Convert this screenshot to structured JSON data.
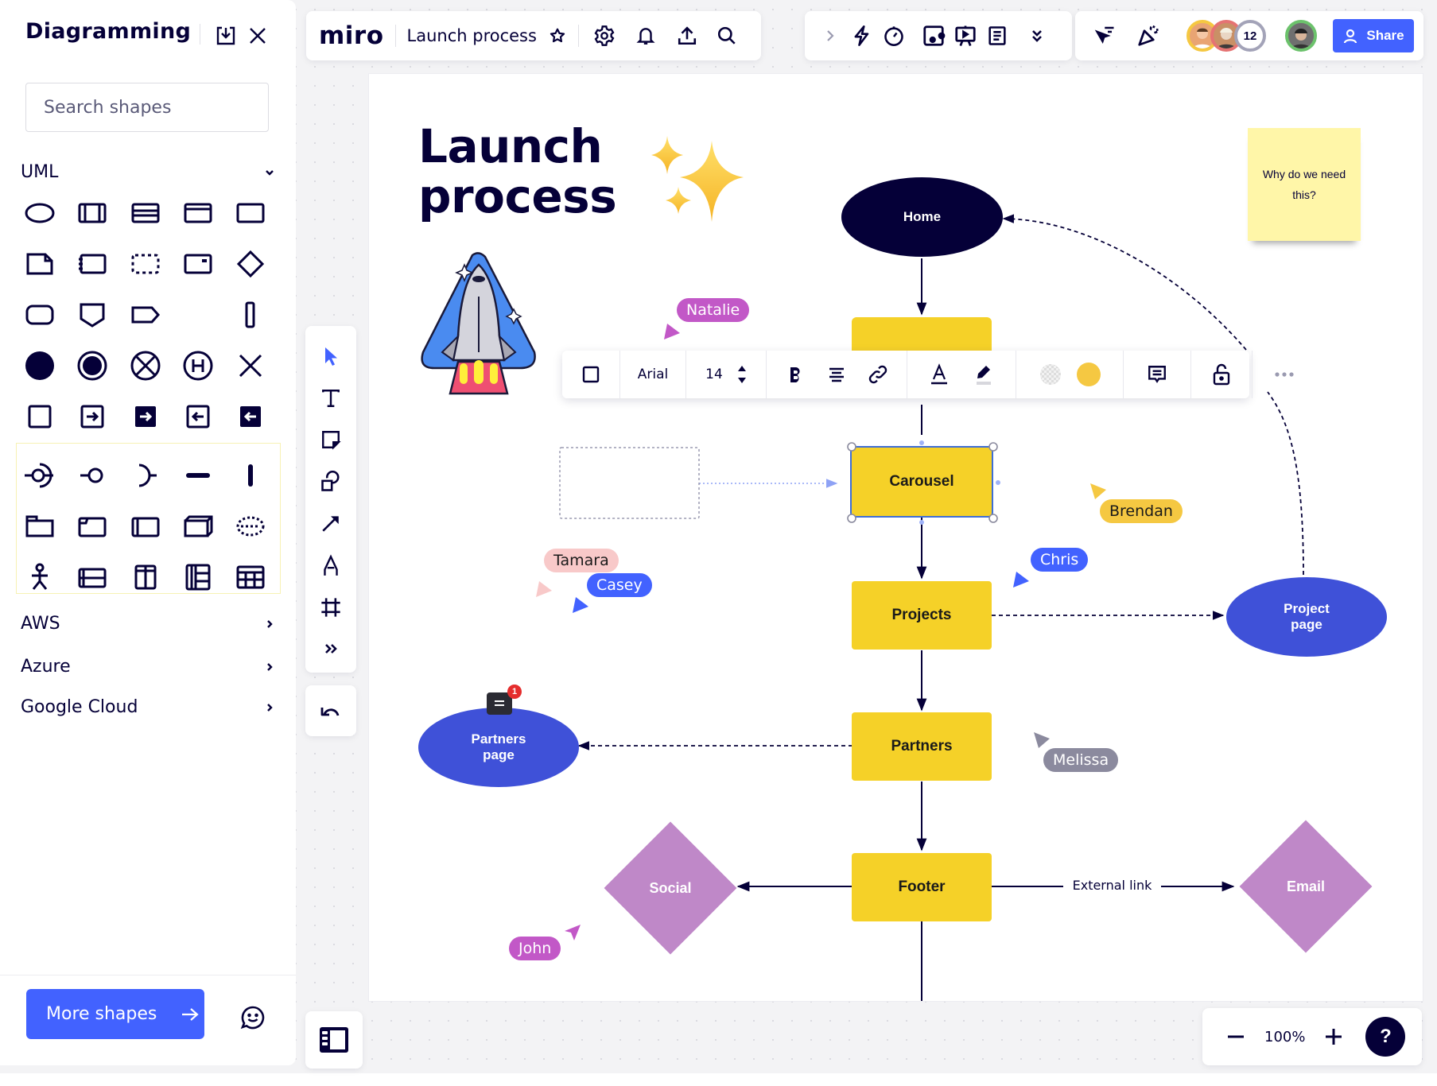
{
  "sidebar": {
    "title": "Diagramming",
    "search_placeholder": "Search shapes",
    "sections": [
      {
        "label": "UML",
        "expanded": true
      },
      {
        "label": "AWS",
        "expanded": false
      },
      {
        "label": "Azure",
        "expanded": false
      },
      {
        "label": "Google Cloud",
        "expanded": false
      }
    ],
    "uml_shapes": [
      "ellipse",
      "class-vertical",
      "class-horizontal",
      "class-header",
      "rectangle",
      "note",
      "component",
      "dashed-box",
      "sub-state",
      "diamond",
      "rounded-rect",
      "pentagon-down",
      "tag",
      "",
      "vertical-bar",
      "initial-state",
      "final-state",
      "terminate",
      "history",
      "cross",
      "square",
      "input-pin",
      "input-pin-filled",
      "output-pin",
      "output-pin-filled",
      "provided-required-interface",
      "provided-interface",
      "required-interface",
      "horizontal-bar",
      "vertical-bar-thick",
      "package",
      "frame",
      "container",
      "node-3d",
      "dashed-ellipse",
      "actor",
      "table-rows",
      "table-columns",
      "table-grid",
      "table"
    ],
    "more_shapes_label": "More shapes"
  },
  "topbar": {
    "logo": "miro",
    "board_name": "Launch process",
    "collaborator_count": "12",
    "share_label": "Share"
  },
  "board": {
    "title_line1": "Launch",
    "title_line2": "process",
    "sticky_note": "Why do we need this?",
    "nodes": {
      "home": "Home",
      "carousel": "Carousel",
      "projects": "Projects",
      "partners": "Partners",
      "footer": "Footer",
      "project_page": "Project page",
      "partners_page": "Partners page",
      "social": "Social",
      "email": "Email"
    },
    "edge_label_external": "External link",
    "comment_badge_count": "1",
    "cursors": [
      {
        "name": "Natalie",
        "color": "#c258c7",
        "text_color": "#ffffff"
      },
      {
        "name": "Brendan",
        "color": "#f5c842",
        "text_color": "#1a1a1a"
      },
      {
        "name": "Chris",
        "color": "#4262ff",
        "text_color": "#ffffff"
      },
      {
        "name": "Tamara",
        "color": "#f8c9c9",
        "text_color": "#1a1a1a"
      },
      {
        "name": "Casey",
        "color": "#4262ff",
        "text_color": "#ffffff"
      },
      {
        "name": "Melissa",
        "color": "#8b8a9e",
        "text_color": "#ffffff"
      },
      {
        "name": "John",
        "color": "#c258c7",
        "text_color": "#ffffff"
      }
    ]
  },
  "context_toolbar": {
    "font_family": "Arial",
    "font_size": "14",
    "fill_color": "#f5c842"
  },
  "zoom": {
    "level": "100%",
    "help_label": "?"
  },
  "colors": {
    "accent": "#4262ff",
    "ink": "#050038",
    "node_yellow": "#f5d128",
    "node_blue": "#3f51d8",
    "node_navy": "#050038",
    "node_purple": "#bf88c8"
  }
}
